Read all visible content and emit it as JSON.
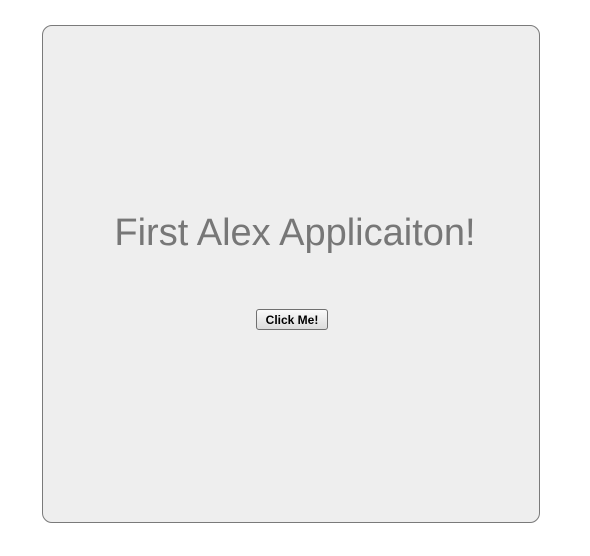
{
  "app": {
    "title": "First Alex Applicaiton!",
    "button_label": "Click Me!"
  }
}
